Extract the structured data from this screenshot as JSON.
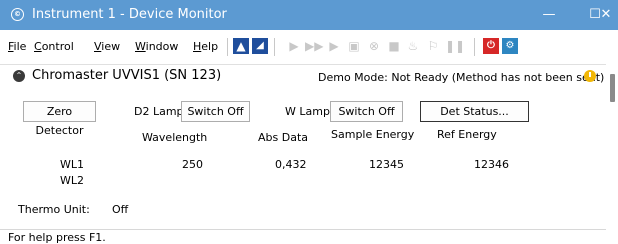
{
  "window": {
    "title": "Instrument 1 - Device Monitor",
    "controls": {
      "minimize": "—",
      "maximize": "☐",
      "close": "✕"
    }
  },
  "menu": [
    {
      "underline": "F",
      "rest": "ile"
    },
    {
      "underline": "C",
      "rest": "ontrol"
    },
    {
      "underline": "V",
      "rest": "iew"
    },
    {
      "underline": "W",
      "rest": "indow"
    },
    {
      "underline": "H",
      "rest": "elp"
    }
  ],
  "instrument": {
    "name": "Chromaster UVVIS1 (SN 123)",
    "status": "Demo Mode: Not Ready (Method has not been sent)"
  },
  "controls": {
    "zero_detector": "Zero Detector",
    "d2_lamp_label": "D2 Lamp",
    "d2_lamp_button": "Switch Off",
    "w_lamp_label": "W Lamp",
    "w_lamp_button": "Switch Off",
    "det_status": "Det Status..."
  },
  "table": {
    "headers": [
      "Wavelength",
      "Abs Data",
      "Sample Energy",
      "Ref Energy"
    ],
    "rows": [
      {
        "name": "WL1",
        "wavelength": "250",
        "abs": "0,432",
        "sample": "12345",
        "ref": "12346"
      },
      {
        "name": "WL2",
        "wavelength": "",
        "abs": "",
        "sample": "",
        "ref": ""
      }
    ]
  },
  "thermo": {
    "label": "Thermo Unit:",
    "value": "Off"
  },
  "status_bar": "For help press F1."
}
